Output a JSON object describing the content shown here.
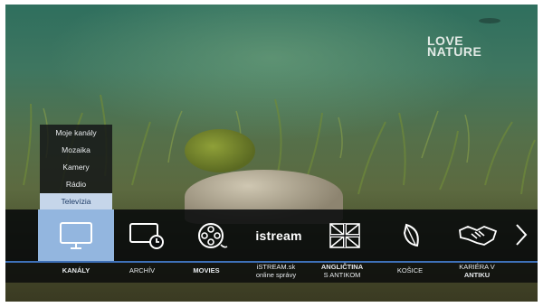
{
  "brand": {
    "line1": "LOVE",
    "line2": "NATURE"
  },
  "submenu": {
    "items": [
      {
        "label": "Moje kanály"
      },
      {
        "label": "Mozaika"
      },
      {
        "label": "Kamery"
      },
      {
        "label": "Rádio"
      },
      {
        "label": "Televízia",
        "active": true
      }
    ]
  },
  "menu": {
    "items": [
      {
        "id": "kanaly",
        "icon": "tv-icon",
        "label": "KANÁLY",
        "selected": true
      },
      {
        "id": "archiv",
        "icon": "screen-clock-icon",
        "label": "ARCHÍV"
      },
      {
        "id": "movies",
        "icon": "film-reel-icon",
        "label": "MOVIES"
      },
      {
        "id": "istream",
        "icon": "istream-logo",
        "logo_text": "istream",
        "label_line1": "iSTREAM.sk",
        "label_line2": "online správy"
      },
      {
        "id": "anglictina",
        "icon": "uk-flag-icon",
        "label_line1": "ANGLIČTINA",
        "label_line2": "S ANTIKOM"
      },
      {
        "id": "kosice",
        "icon": "leaf-icon",
        "label": "KOŠICE"
      },
      {
        "id": "kariera",
        "icon": "handshake-icon",
        "label_line1": "KARIÉRA V",
        "label_line2": "ANTIKU"
      }
    ],
    "next_arrow_icon": "chevron-right-icon"
  },
  "colors": {
    "selected_tile": "#93b6df",
    "accent_line": "#3e70b8",
    "submenu_active": "#c6d6ea"
  }
}
